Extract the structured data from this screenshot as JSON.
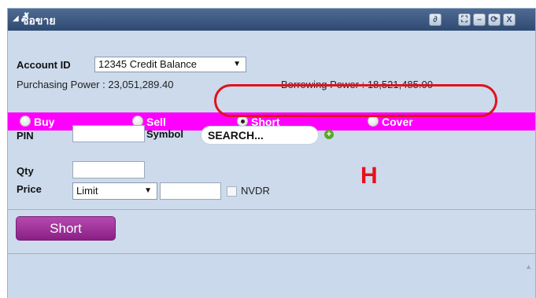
{
  "window": {
    "title": "ซื้อขาย",
    "title_icon": "triangle-down-icon",
    "controls": [
      "link-icon",
      "expand-icon",
      "minimize-icon",
      "refresh-icon",
      "close-icon"
    ],
    "control_glyphs": {
      "link": "∂",
      "expand": "⛶",
      "minimize": "–",
      "refresh": "⟳",
      "close": "X"
    }
  },
  "account": {
    "label": "Account ID",
    "value": "12345 Credit Balance",
    "arrow": "▼",
    "purchasing_power": "Purchasing Power : 23,051,289.40",
    "borrowing_power": "Borrowing Power : 18,521,485.00"
  },
  "sides": {
    "buy": "Buy",
    "sell": "Sell",
    "short": "Short",
    "cover": "Cover",
    "selected": "Short",
    "bar_color": "#ff00ff",
    "highlight_color": "#e0121b"
  },
  "order": {
    "pin_label": "PIN",
    "symbol_label": "Symbol",
    "symbol_placeholder": "SEARCH...",
    "qty_label": "Qty",
    "price_label": "Price",
    "price_type": "Limit",
    "price_arrow": "▼",
    "nvdr_label": "NVDR"
  },
  "annotation": {
    "text": "H"
  },
  "action": {
    "submit_label": "Short",
    "button_color": "#9a2a95"
  }
}
